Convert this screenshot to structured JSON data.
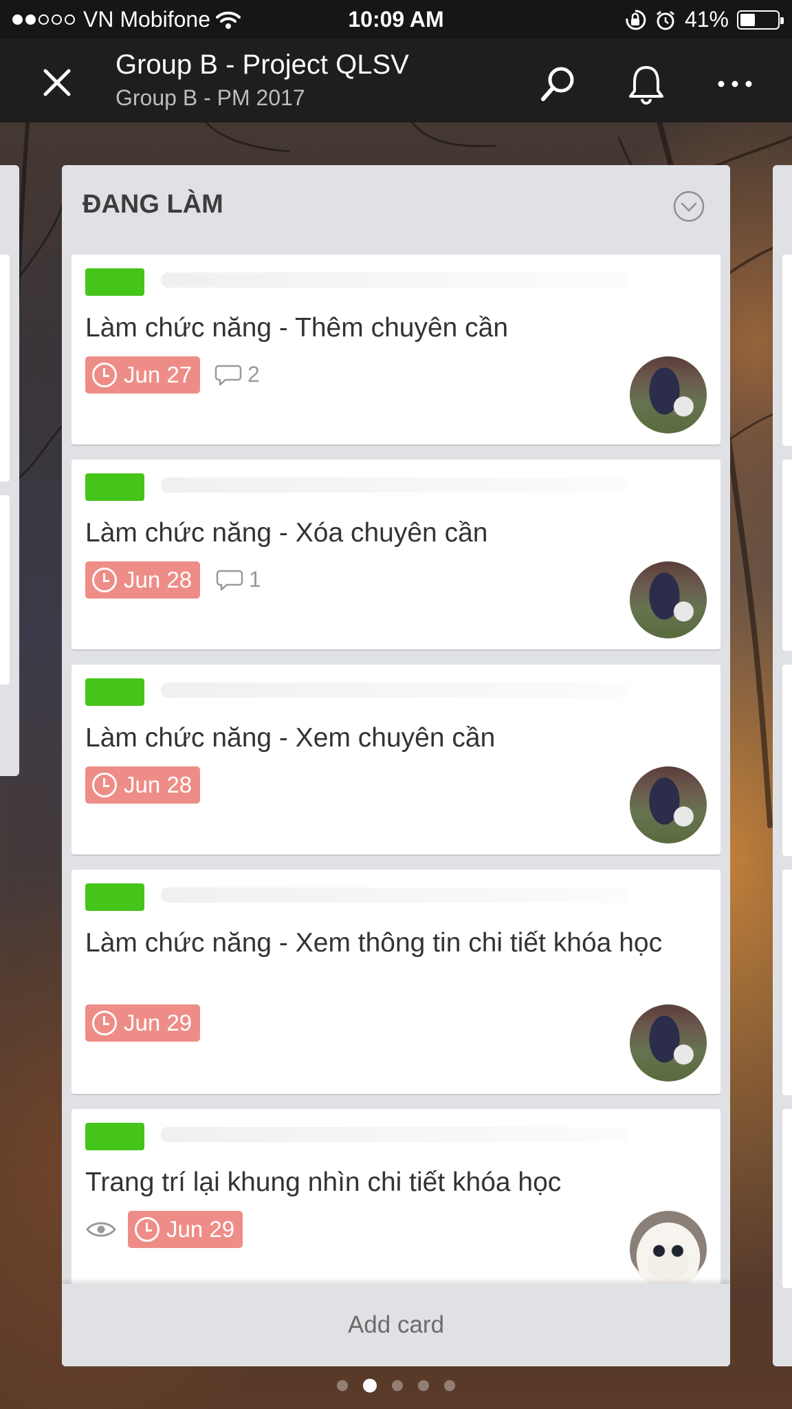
{
  "status_bar": {
    "carrier": "VN Mobifone",
    "time": "10:09 AM",
    "battery": "41%",
    "battery_level": 0.41,
    "signal_bars": 2,
    "signal_total": 5
  },
  "header": {
    "title": "Group B - Project QLSV",
    "subtitle": "Group B - PM 2017",
    "icons": [
      "close-icon",
      "search-icon",
      "bell-icon",
      "more-icon"
    ]
  },
  "list": {
    "title": "ĐANG LÀM",
    "add_card_label": "Add card",
    "cards": [
      {
        "label_color": "#45c41a",
        "title": "Làm chức năng - Thêm chuyên cần",
        "due": "Jun 27",
        "comments": "2",
        "avatar": "panda"
      },
      {
        "label_color": "#45c41a",
        "title": "Làm chức năng - Xóa chuyên cần",
        "due": "Jun 28",
        "comments": "1",
        "avatar": "panda"
      },
      {
        "label_color": "#45c41a",
        "title": "Làm chức năng - Xem chuyên cần",
        "due": "Jun 28",
        "avatar": "panda"
      },
      {
        "label_color": "#45c41a",
        "title": "Làm chức năng - Xem thông tin chi tiết khóa học",
        "due": "Jun 29",
        "avatar": "panda"
      },
      {
        "label_color": "#45c41a",
        "title": "Trang trí lại khung nhìn chi tiết khóa học",
        "due": "Jun 29",
        "watching": true,
        "avatar": "cat"
      }
    ]
  },
  "pager": {
    "count": 5,
    "active_index": 1
  },
  "colors": {
    "due_badge": "#ee8d87",
    "label_green": "#45c41a",
    "list_bg": "#dfe1e5",
    "header_bg": "#1f1e1d"
  }
}
